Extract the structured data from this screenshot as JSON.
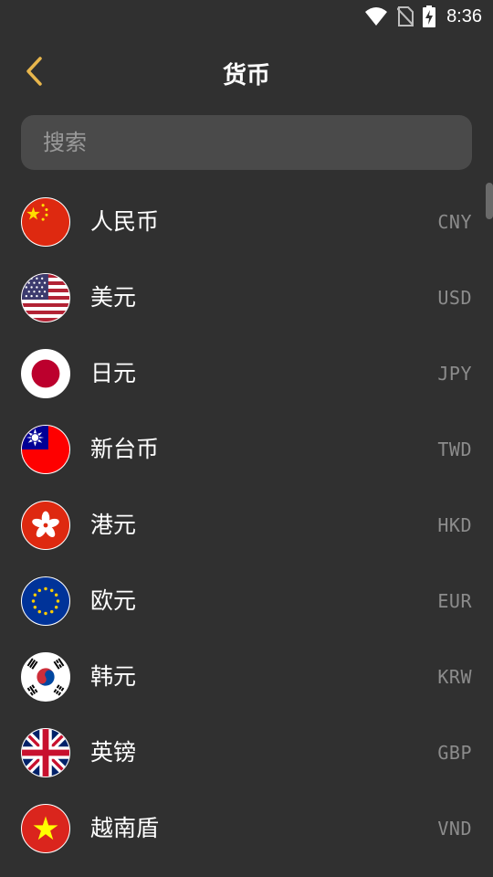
{
  "status_bar": {
    "time": "8:36"
  },
  "header": {
    "title": "货币"
  },
  "search": {
    "placeholder": "搜索"
  },
  "colors": {
    "accent": "#E8B64C",
    "background": "#303030",
    "search_bg": "#4A4A4A",
    "code_text": "#8C8C8C"
  },
  "currencies": [
    {
      "name": "人民币",
      "code": "CNY",
      "flag": "china-flag-icon"
    },
    {
      "name": "美元",
      "code": "USD",
      "flag": "usa-flag-icon"
    },
    {
      "name": "日元",
      "code": "JPY",
      "flag": "japan-flag-icon"
    },
    {
      "name": "新台币",
      "code": "TWD",
      "flag": "taiwan-flag-icon"
    },
    {
      "name": "港元",
      "code": "HKD",
      "flag": "hong-kong-flag-icon"
    },
    {
      "name": "欧元",
      "code": "EUR",
      "flag": "eu-flag-icon"
    },
    {
      "name": "韩元",
      "code": "KRW",
      "flag": "south-korea-flag-icon"
    },
    {
      "name": "英镑",
      "code": "GBP",
      "flag": "uk-flag-icon"
    },
    {
      "name": "越南盾",
      "code": "VND",
      "flag": "vietnam-flag-icon"
    }
  ]
}
